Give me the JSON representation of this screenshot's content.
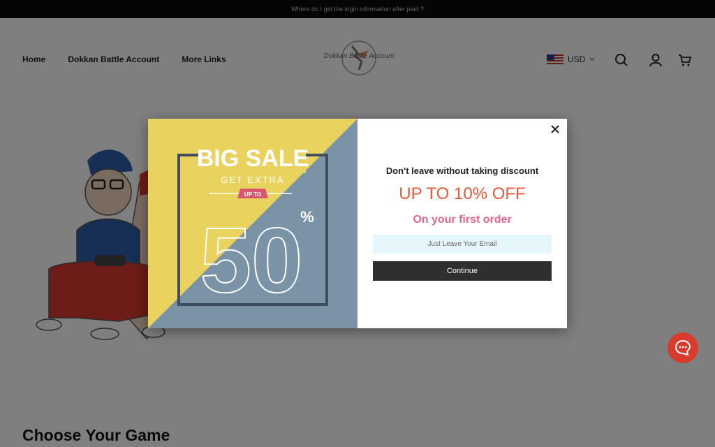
{
  "announcement": "Where do I get the login information after paid ?",
  "nav": {
    "home": "Home",
    "dokkan": "Dokkan Battle Account",
    "more": "More Links"
  },
  "logo_text": "Dokkan Battle Account",
  "currency": "USD",
  "section_title": "Choose Your Game",
  "popup": {
    "banner": {
      "headline": "BIG SALE",
      "get_extra": "GET EXTRA",
      "up_to": "UP TO",
      "number": "50",
      "percent": "%"
    },
    "title": "Don't leave without taking discount",
    "offer": "UP TO 10% OFF",
    "subtitle": "On your first order",
    "email_placeholder": "Just Leave Your Email",
    "continue_label": "Continue"
  },
  "colors": {
    "banner_yellow": "#e9d25e",
    "banner_blue": "#7b93a6",
    "offer_orange": "#e8573a",
    "subtitle_pink": "#e4658a",
    "chat_red": "#d83a2e"
  }
}
